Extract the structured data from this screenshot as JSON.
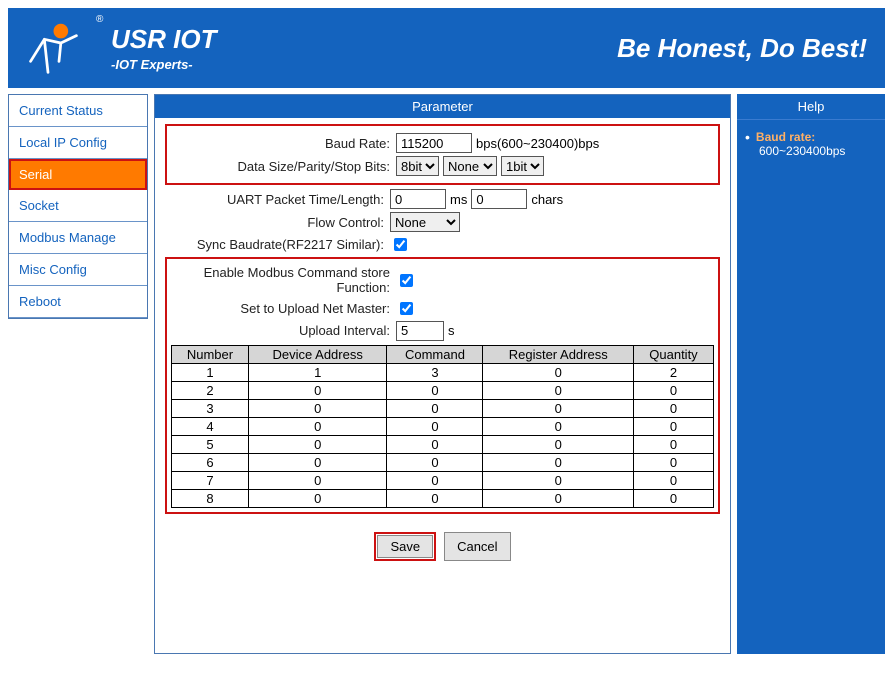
{
  "header": {
    "brand": "USR IOT",
    "sub": "-IOT Experts-",
    "slogan": "Be Honest, Do Best!"
  },
  "sidebar": {
    "items": [
      {
        "label": "Current Status"
      },
      {
        "label": "Local IP Config"
      },
      {
        "label": "Serial"
      },
      {
        "label": "Socket"
      },
      {
        "label": "Modbus Manage"
      },
      {
        "label": "Misc Config"
      },
      {
        "label": "Reboot"
      }
    ]
  },
  "main": {
    "title": "Parameter",
    "labels": {
      "baud_rate": "Baud Rate:",
      "baud_unit": "bps(600~230400)bps",
      "dsp": "Data Size/Parity/Stop Bits:",
      "packet": "UART Packet Time/Length:",
      "ms": "ms",
      "chars": "chars",
      "flow": "Flow Control:",
      "sync": "Sync Baudrate(RF2217 Similar):",
      "modbus_fn": "Enable Modbus Command store Function:",
      "upload_master": "Set to Upload Net Master:",
      "upload_interval": "Upload Interval:",
      "seconds": "s"
    },
    "values": {
      "baud_rate": "115200",
      "data_size": "8bit",
      "parity": "None",
      "stop_bits": "1bit",
      "packet_time": "0",
      "packet_len": "0",
      "flow": "None",
      "upload_interval": "5"
    },
    "table": {
      "headers": [
        "Number",
        "Device Address",
        "Command",
        "Register Address",
        "Quantity"
      ],
      "rows": [
        [
          "1",
          "1",
          "3",
          "0",
          "2"
        ],
        [
          "2",
          "0",
          "0",
          "0",
          "0"
        ],
        [
          "3",
          "0",
          "0",
          "0",
          "0"
        ],
        [
          "4",
          "0",
          "0",
          "0",
          "0"
        ],
        [
          "5",
          "0",
          "0",
          "0",
          "0"
        ],
        [
          "6",
          "0",
          "0",
          "0",
          "0"
        ],
        [
          "7",
          "0",
          "0",
          "0",
          "0"
        ],
        [
          "8",
          "0",
          "0",
          "0",
          "0"
        ]
      ]
    },
    "buttons": {
      "save": "Save",
      "cancel": "Cancel"
    }
  },
  "help": {
    "title": "Help",
    "item_label": "Baud rate:",
    "item_text": "600~230400bps"
  }
}
